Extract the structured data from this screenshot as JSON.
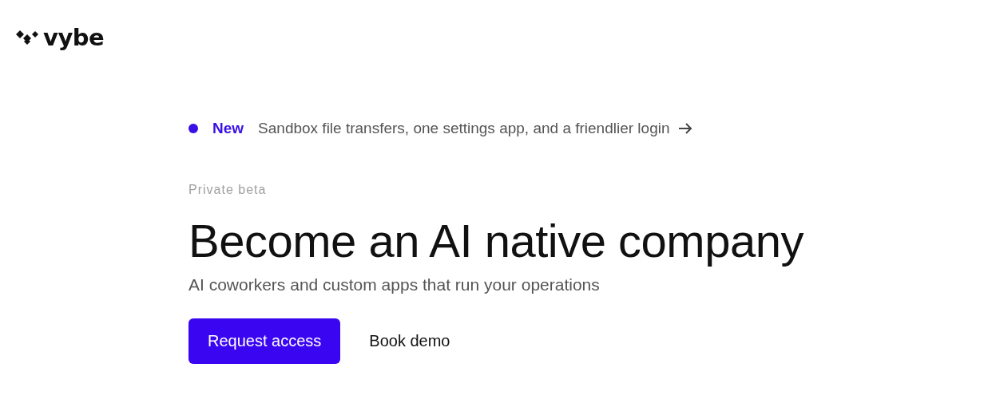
{
  "logo": {
    "text": "vybe"
  },
  "announcement": {
    "badge": "New",
    "text": "Sandbox file transfers, one settings app, and a friendlier login"
  },
  "hero": {
    "eyebrow": "Private beta",
    "title": "Become an AI native company",
    "subtitle": "AI coworkers and custom apps that run your operations"
  },
  "buttons": [
    {
      "label": "Request access",
      "kind": "primary"
    },
    {
      "label": "Book demo",
      "kind": "secondary"
    }
  ]
}
